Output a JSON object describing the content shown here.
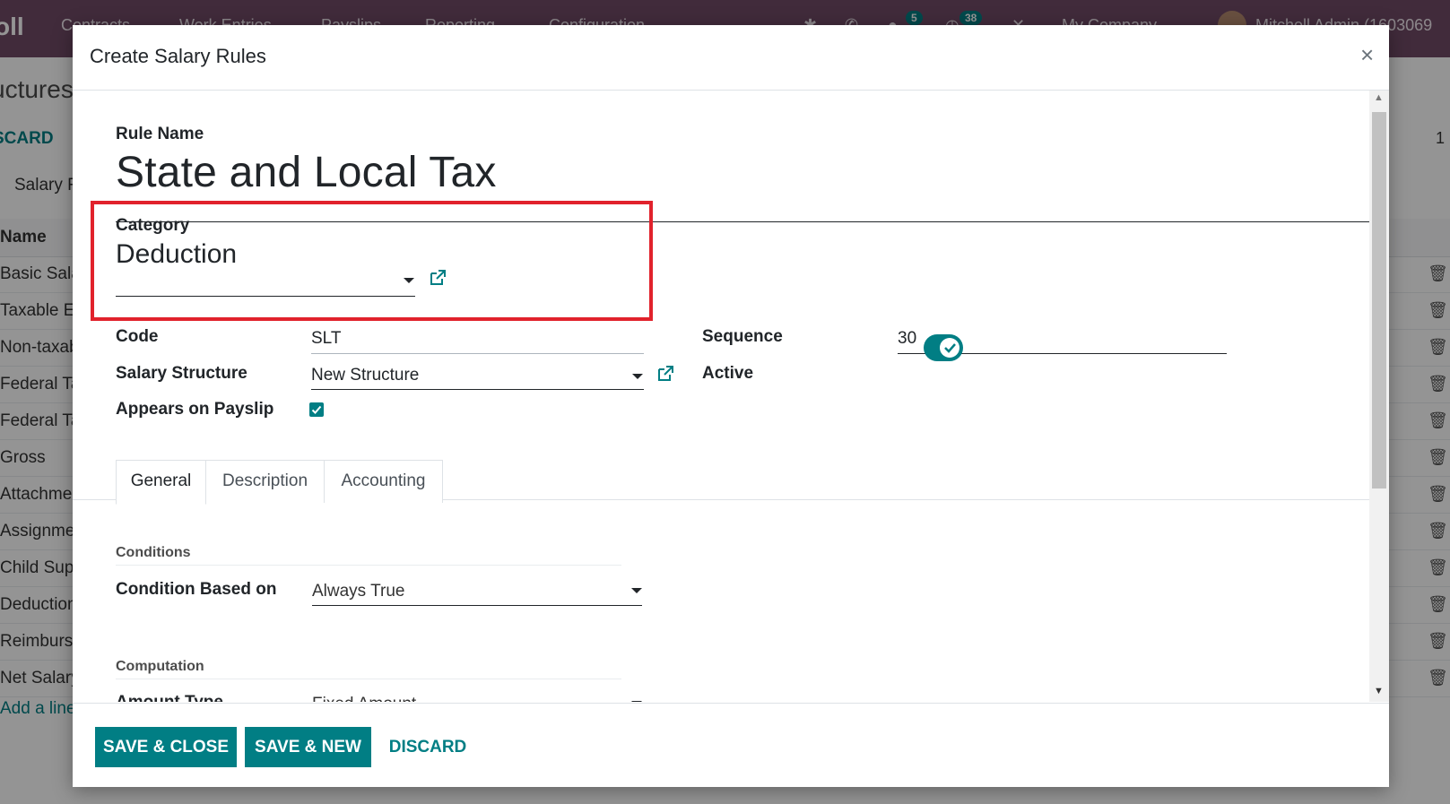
{
  "app": {
    "brand": "oll",
    "menu": [
      "Contracts",
      "Work Entries",
      "Payslips",
      "Reporting",
      "Configuration"
    ],
    "badges": {
      "messages": "5",
      "activities": "38"
    },
    "company": "My Company",
    "user": "Mitchell Admin (1603069"
  },
  "background": {
    "breadcrumb": "uctures",
    "discard": "SCARD",
    "pager": "1",
    "tab": "Salary R",
    "column_header": "Name",
    "rows": [
      "Basic Sala",
      "Taxable E",
      "Non-taxab",
      "Federal Ta",
      "Federal Ta",
      "Gross",
      "Attachme",
      "Assignme",
      "Child Sup",
      "Deduction",
      "Reimburs",
      "Net Salary"
    ],
    "add_line": "Add a line"
  },
  "dialog": {
    "title": "Create Salary Rules",
    "close": "×",
    "rule_name_label": "Rule Name",
    "rule_name_value": "State and Local Tax",
    "category_label": "Category",
    "category_value": "Deduction",
    "code_label": "Code",
    "code_value": "SLT",
    "sequence_label": "Sequence",
    "sequence_value": "30",
    "salary_structure_label": "Salary Structure",
    "salary_structure_value": "New Structure",
    "active_label": "Active",
    "active_value": true,
    "appears_on_payslip_label": "Appears on Payslip",
    "appears_on_payslip_value": true,
    "tabs": [
      "General",
      "Description",
      "Accounting"
    ],
    "active_tab": "General",
    "conditions_heading": "Conditions",
    "condition_based_on_label": "Condition Based on",
    "condition_based_on_value": "Always True",
    "computation_heading": "Computation",
    "amount_type_label": "Amount Type",
    "amount_type_value": "Fixed Amount"
  },
  "footer": {
    "save_close": "SAVE & CLOSE",
    "save_new": "SAVE & NEW",
    "discard": "DISCARD"
  },
  "colors": {
    "brand_purple": "#714b67",
    "accent_teal": "#017e84",
    "highlight_red": "#e1222c"
  }
}
